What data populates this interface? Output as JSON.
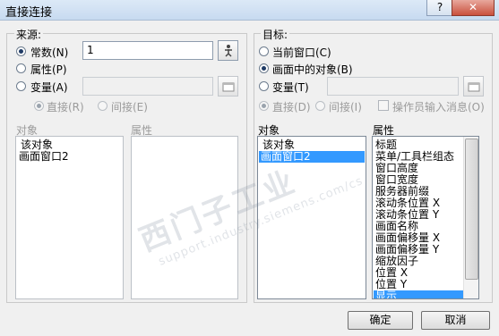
{
  "window": {
    "title": "直接连接",
    "help_btn": "?",
    "close_btn": "✕"
  },
  "source": {
    "legend": "来源:",
    "constant_label": "常数(N)",
    "constant_value": "1",
    "property_label": "属性(P)",
    "variable_label": "变量(A)",
    "variable_value": "",
    "direct_label": "直接(R)",
    "indirect_label": "间接(E)",
    "object_header": "对象",
    "property_header": "属性",
    "objects": [
      "该对象",
      "画面窗口2"
    ],
    "properties": []
  },
  "target": {
    "legend": "目标:",
    "current_window_label": "当前窗口(C)",
    "object_in_screen_label": "画面中的对象(B)",
    "variable_label": "变量(T)",
    "variable_value": "",
    "direct_label": "直接(D)",
    "indirect_label": "间接(I)",
    "operator_msg_label": "操作员输入消息(O)",
    "object_header": "对象",
    "property_header": "属性",
    "objects": [
      "该对象",
      "画面窗口2"
    ],
    "selected_object": "画面窗口2",
    "properties": [
      "标题",
      "菜单/工具栏组态",
      "窗口高度",
      "窗口宽度",
      "服务器前缀",
      "滚动条位置 X",
      "滚动条位置 Y",
      "画面名称",
      "画面偏移量 X",
      "画面偏移量 Y",
      "缩放因子",
      "位置 X",
      "位置 Y",
      "显示"
    ],
    "selected_property": "显示"
  },
  "buttons": {
    "ok": "确定",
    "cancel": "取消"
  },
  "watermark": {
    "line1": "西门子工业",
    "line2": "support.industry.siemens.com/cs"
  }
}
